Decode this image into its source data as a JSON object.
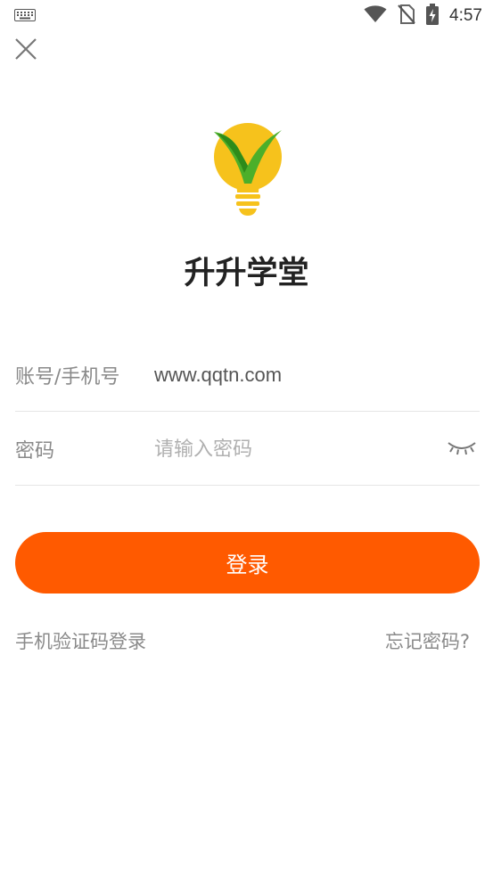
{
  "status_bar": {
    "time": "4:57",
    "icons": [
      "keyboard-icon",
      "wifi-icon",
      "no-sim-icon",
      "battery-charging-icon"
    ]
  },
  "header": {
    "close_icon": "close-icon"
  },
  "brand": {
    "logo": "lightbulb-checkmark-logo",
    "title": "升升学堂",
    "colors": {
      "bulb": "#f6c21c",
      "check": "#4caf2a"
    }
  },
  "form": {
    "account": {
      "label": "账号/手机号",
      "value": "www.qqtn.com"
    },
    "password": {
      "label": "密码",
      "value": "",
      "placeholder": "请输入密码",
      "toggle_icon": "eye-closed-icon"
    }
  },
  "actions": {
    "login_label": "登录",
    "login_color": "#ff5a00",
    "sms_login_label": "手机验证码登录",
    "forgot_password_label": "忘记密码?"
  }
}
